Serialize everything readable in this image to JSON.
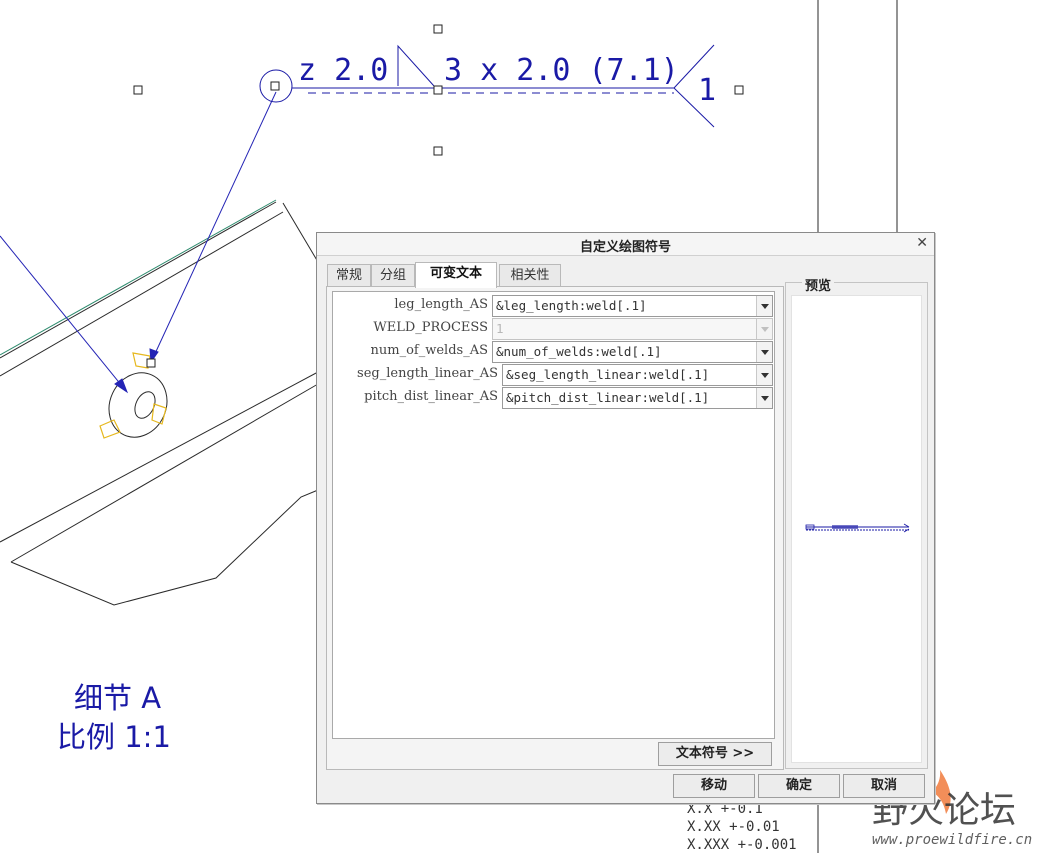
{
  "drawing": {
    "weld_symbol": {
      "left_text": "z 2.0",
      "right_text": "3 x 2.0 (7.1)",
      "tail_text": "1"
    },
    "detail_title": "细节 A",
    "scale_label": "比例 1:1",
    "tolerance_rows": [
      "X.X   +-0.1",
      "X.XX  +-0.01",
      "X.XXX +-0.001"
    ],
    "colors": {
      "annotation": "#1a1aa6",
      "leader": "#2424b5",
      "edge": "#2a2a2a",
      "highlight": "#e6b81e",
      "green_edge": "#2e8b6e"
    }
  },
  "dialog": {
    "title": "自定义绘图符号",
    "close_icon": "close-icon",
    "tabs": [
      {
        "label": "常规",
        "active": false
      },
      {
        "label": "分组",
        "active": false
      },
      {
        "label": "可变文本",
        "active": true
      },
      {
        "label": "相关性",
        "active": false
      }
    ],
    "variables": [
      {
        "label": "leg_length_AS",
        "value": "&leg_length:weld[.1]",
        "enabled": true
      },
      {
        "label": "WELD_PROCESS",
        "value": "1",
        "enabled": false
      },
      {
        "label": "num_of_welds_AS",
        "value": "&num_of_welds:weld[.1]",
        "enabled": true
      },
      {
        "label": "seg_length_linear_AS",
        "value": "&seg_length_linear:weld[.1]",
        "enabled": true
      },
      {
        "label": "pitch_dist_linear_AS",
        "value": "&pitch_dist_linear:weld[.1]",
        "enabled": true
      }
    ],
    "text_symbol_button": "文本符号 >>",
    "preview_label": "预览",
    "buttons": {
      "move": "移动",
      "ok": "确定",
      "cancel": "取消"
    }
  },
  "watermark": {
    "brand": "野火论坛",
    "url": "www.proewildfire.cn"
  }
}
